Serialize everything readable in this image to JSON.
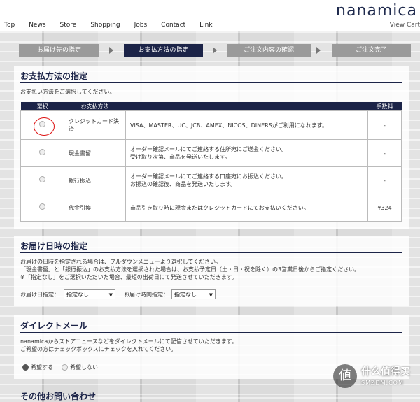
{
  "header": {
    "logo": "nanamica",
    "nav": [
      "Top",
      "News",
      "Store",
      "Shopping",
      "Jobs",
      "Contact",
      "Link"
    ],
    "active_nav": "Shopping",
    "view_cart": "View Cart"
  },
  "steps": [
    "お届け先の指定",
    "お支払方法の指定",
    "ご注文内容の確認",
    "ご注文完了"
  ],
  "payment": {
    "title": "お支払方法の指定",
    "instruction": "お支払い方法をご選択してください。",
    "headers": [
      "選択",
      "お支払方法",
      "",
      "手数料"
    ],
    "rows": [
      {
        "method": "クレジットカード決済",
        "desc": "VISA、MASTER、UC、JCB、AMEX、NICOS、DINERSがご利用になれます。",
        "fee": "-"
      },
      {
        "method": "現金書留",
        "desc": "オーダー確認メールにてご連絡する住所宛にご送金ください。\n受け取り次第、商品を発送いたします。",
        "fee": "-"
      },
      {
        "method": "銀行振込",
        "desc": "オーダー確認メールにてご連絡する口座宛にお振込ください。\nお振込の確認後、商品を発送いたします。",
        "fee": "-"
      },
      {
        "method": "代金引換",
        "desc": "商品引き取り時に現金またはクレジットカードにてお支払いください。",
        "fee": "¥324"
      }
    ]
  },
  "delivery": {
    "title": "お届け日時の指定",
    "lines": [
      "お届けの日時を指定される場合は、プルダウンメニューより選択してください。",
      "「現金書留」と「銀行振込」のお支払方法を選択された場合は、お支払予定日（土・日・祝を除く）の3営業日後からご指定ください。",
      "※「指定なし」をご選択いただいた場合、最短の出荷日にて発送させていただきます。"
    ],
    "date_label": "お届け日指定：",
    "date_value": "指定なし",
    "time_label": "お届け時間指定：",
    "time_value": "指定なし"
  },
  "direct_mail": {
    "title": "ダイレクトメール",
    "lines": [
      "nanamicaからストアニュースなどをダイレクトメールにて配信させていただきます。",
      "ご希望の方はチェックボックスにチェックを入れてください。"
    ],
    "opt_yes": "希望する",
    "opt_no": "希望しない"
  },
  "next_section": {
    "title": "その他お問い合わせ"
  },
  "watermark": {
    "glyph": "値",
    "text": "什么值得买",
    "sub": "SMZDM.COM"
  },
  "colors": {
    "navy": "#1c2448",
    "highlight": "#dd1111"
  }
}
